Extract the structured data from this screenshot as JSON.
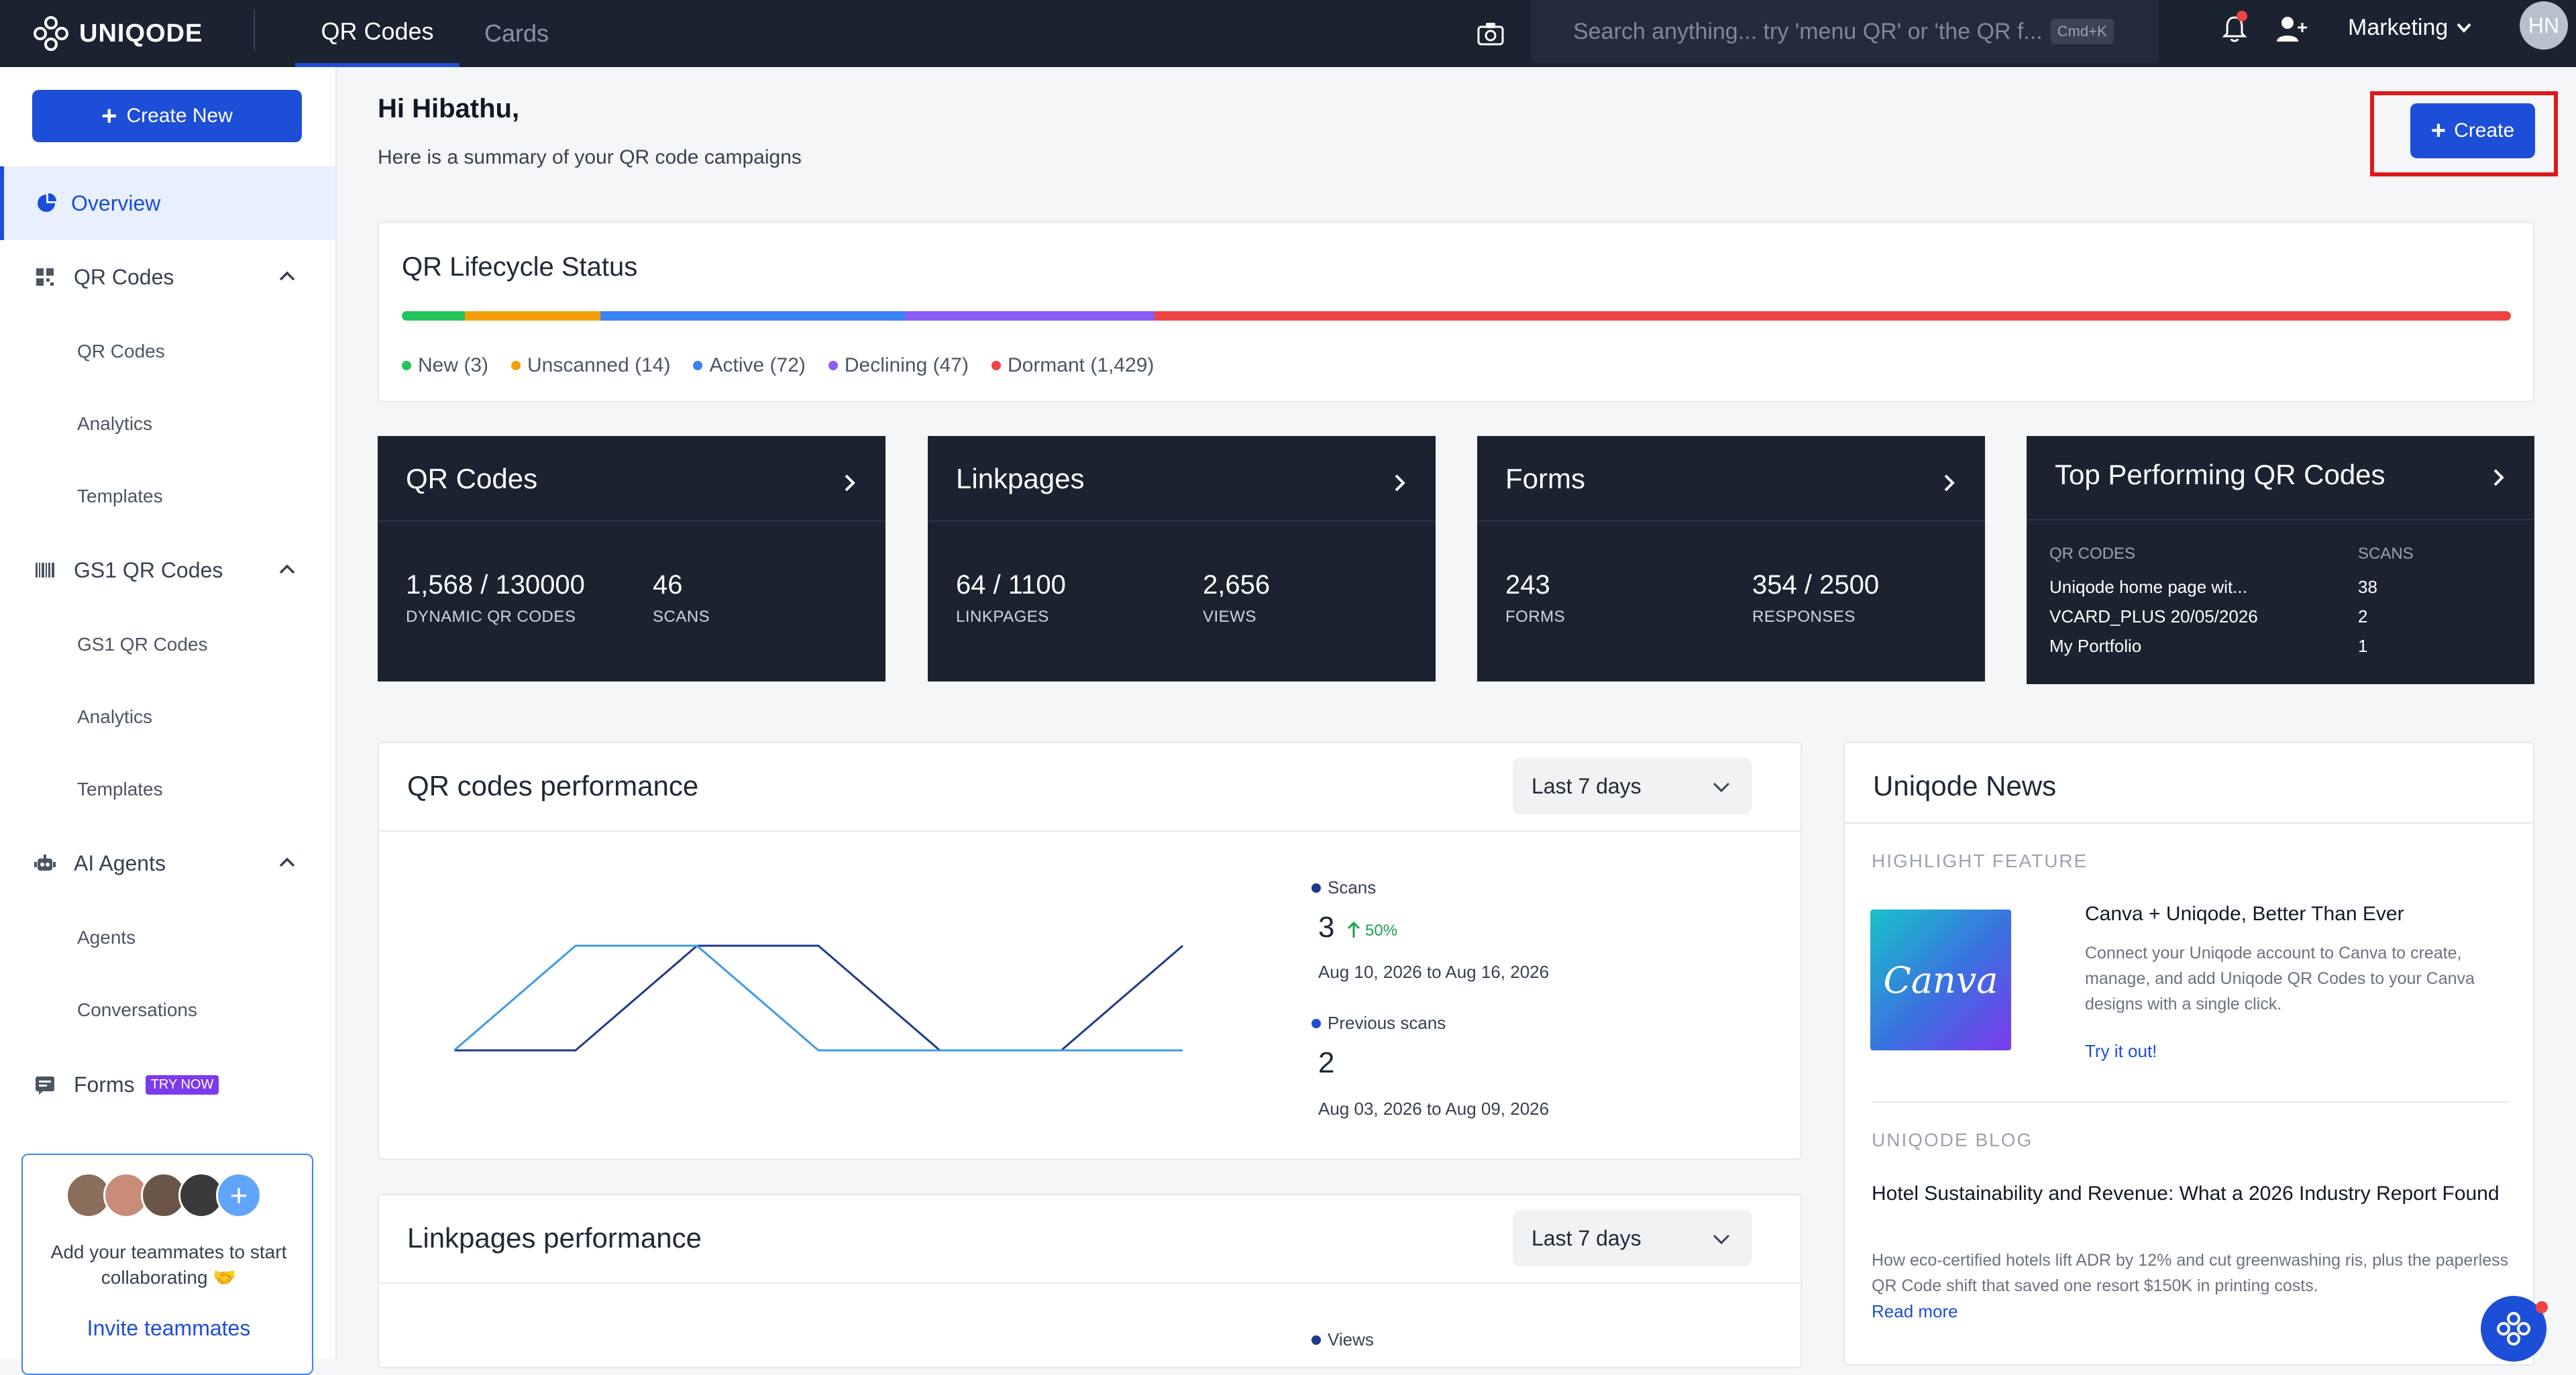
{
  "brand": {
    "name": "UNIQODE"
  },
  "topnav": {
    "tabs": [
      {
        "label": "QR Codes",
        "active": true
      },
      {
        "label": "Cards",
        "active": false
      }
    ],
    "search": {
      "placeholder": "Search anything... try 'menu QR' or 'the QR f...",
      "shortcut": "Cmd+K"
    },
    "workspace": "Marketing",
    "user_initials": "HN"
  },
  "sidebar": {
    "create_new": "Create New",
    "overview": "Overview",
    "groups": [
      {
        "label": "QR Codes",
        "icon": "qr-grid-icon",
        "items": [
          "QR Codes",
          "Analytics",
          "Templates"
        ]
      },
      {
        "label": "GS1 QR Codes",
        "icon": "barcode-icon",
        "items": [
          "GS1 QR Codes",
          "Analytics",
          "Templates"
        ]
      },
      {
        "label": "AI Agents",
        "icon": "robot-icon",
        "items": [
          "Agents",
          "Conversations"
        ]
      },
      {
        "label": "Forms",
        "icon": "form-icon",
        "badge": "TRY NOW"
      }
    ],
    "invite": {
      "text": "Add your teammates to start collaborating 🤝",
      "link": "Invite teammates"
    }
  },
  "header": {
    "greeting": "Hi Hibathu,",
    "subtitle": "Here is a summary of your QR code campaigns",
    "create_button": "Create"
  },
  "lifecycle": {
    "title": "QR Lifecycle Status",
    "segments": [
      {
        "label": "New (3)",
        "color": "#22c55e",
        "share": 0.03
      },
      {
        "label": "Unscanned (14)",
        "color": "#f59e0b",
        "share": 0.064
      },
      {
        "label": "Active (72)",
        "color": "#3b82f6",
        "share": 0.145
      },
      {
        "label": "Declining (47)",
        "color": "#8b5cf6",
        "share": 0.118
      },
      {
        "label": "Dormant (1,429)",
        "color": "#ef4444",
        "share": 0.643
      }
    ]
  },
  "cards": {
    "qr_codes": {
      "title": "QR Codes",
      "v1": "1,568 / 130000",
      "l1": "DYNAMIC QR CODES",
      "v2": "46",
      "l2": "SCANS"
    },
    "linkpages": {
      "title": "Linkpages",
      "v1": "64 / 1100",
      "l1": "LINKPAGES",
      "v2": "2,656",
      "l2": "VIEWS"
    },
    "forms": {
      "title": "Forms",
      "v1": "243",
      "l1": "FORMS",
      "v2": "354 / 2500",
      "l2": "RESPONSES"
    },
    "top": {
      "title": "Top Performing QR Codes",
      "col1": "QR CODES",
      "col2": "SCANS",
      "rows": [
        {
          "name": "Uniqode home page wit...",
          "scans": "38"
        },
        {
          "name": "VCARD_PLUS 20/05/2026",
          "scans": "2"
        },
        {
          "name": "My Portfolio",
          "scans": "1"
        }
      ]
    }
  },
  "qr_perf": {
    "title": "QR codes performance",
    "range": "Last 7 days",
    "scans_label": "Scans",
    "scans_value": "3",
    "scans_change": "50%",
    "scans_dates": "Aug 10, 2026 to Aug 16, 2026",
    "prev_label": "Previous scans",
    "prev_value": "2",
    "prev_dates": "Aug 03, 2026 to Aug 09, 2026",
    "colors": {
      "current": "#1e3a8a",
      "previous": "#3b9be8"
    }
  },
  "chart_data": {
    "type": "line",
    "x": [
      1,
      2,
      3,
      4,
      5,
      6,
      7
    ],
    "series": [
      {
        "name": "Scans",
        "values": [
          0,
          0,
          1,
          1,
          0,
          0,
          1
        ]
      },
      {
        "name": "Previous scans",
        "values": [
          0,
          1,
          1,
          0,
          0,
          0,
          0
        ]
      }
    ]
  },
  "link_perf": {
    "title": "Linkpages performance",
    "range": "Last 7 days",
    "views_label": "Views"
  },
  "news": {
    "title": "Uniqode News",
    "highlight_label": "HIGHLIGHT FEATURE",
    "canva_logo": "Canva",
    "feature_title": "Canva + Uniqode, Better Than Ever",
    "feature_desc": "Connect your Uniqode account to Canva to create, manage, and add Uniqode QR Codes to your Canva designs with a single click.",
    "feature_link": "Try it out!",
    "blog_label": "UNIQODE BLOG",
    "blog_title": "Hotel Sustainability and Revenue: What a 2026 Industry Report Found",
    "blog_desc": "How eco-certified hotels lift ADR by 12% and cut greenwashing ris, plus the paperless QR Code shift that saved one resort $150K in printing costs.",
    "blog_link": "Read more"
  }
}
